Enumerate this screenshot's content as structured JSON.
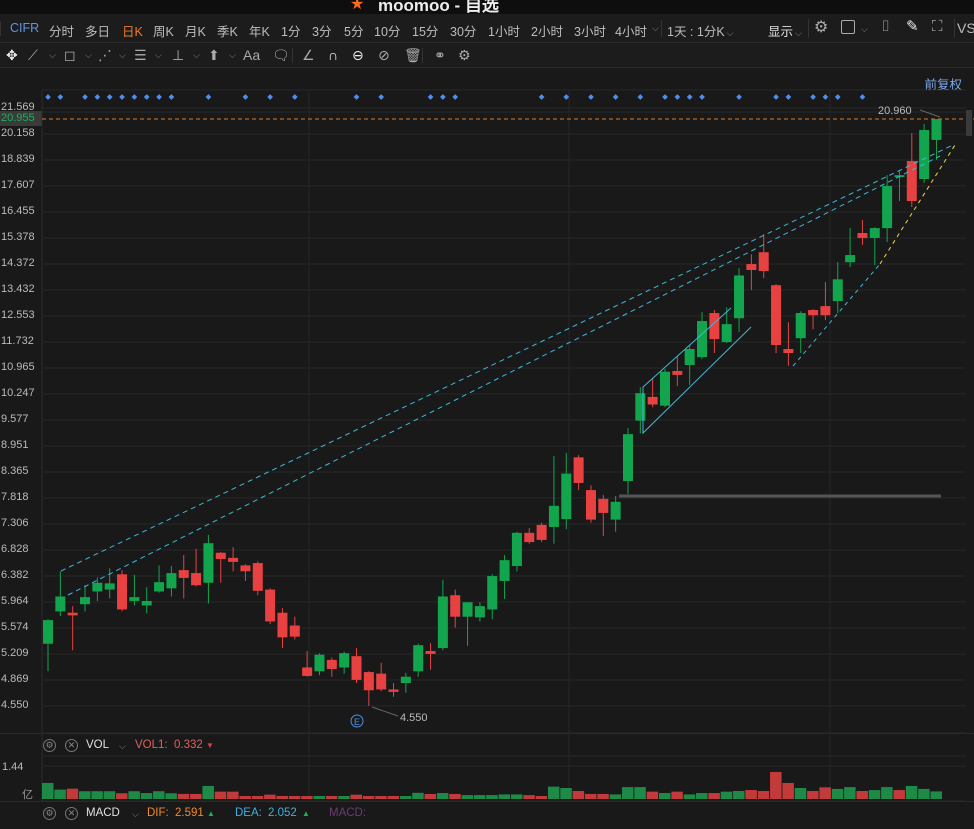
{
  "window": {
    "title": "moomoo - 自选",
    "logo": "moomoo-logo"
  },
  "toolbar": {
    "symbol": "CIFR",
    "periods": [
      "分时",
      "多日",
      "日K",
      "周K",
      "月K",
      "季K",
      "年K",
      "1分",
      "3分",
      "5分",
      "10分",
      "15分",
      "30分",
      "1小时",
      "2小时",
      "3小时",
      "4小时"
    ],
    "active_period": "日K",
    "multi_period": "1天 : 1分K",
    "display_label": "显示",
    "cut_label": "VS",
    "icons": [
      "gear-icon",
      "square-icon",
      "camera-icon",
      "pencil-icon",
      "fullscreen-icon"
    ]
  },
  "drawing_tools": [
    {
      "name": "move-icon",
      "glyph": "✥"
    },
    {
      "name": "trend-line-icon",
      "glyph": "⟋"
    },
    {
      "name": "rectangle-icon",
      "glyph": "◻"
    },
    {
      "name": "polyline-icon",
      "glyph": "⋰"
    },
    {
      "name": "fibonacci-icon",
      "glyph": "☰"
    },
    {
      "name": "measure-icon",
      "glyph": "⊥"
    },
    {
      "name": "arrow-up-icon",
      "glyph": "⬆"
    },
    {
      "name": "text-icon",
      "glyph": "Aa"
    },
    {
      "name": "comment-icon",
      "glyph": "🗨"
    },
    {
      "name": "angle-icon",
      "glyph": "∠"
    },
    {
      "name": "magnet-icon",
      "glyph": "∩"
    },
    {
      "name": "link-icon",
      "glyph": "⊖"
    },
    {
      "name": "hide-icon",
      "glyph": "⊘"
    },
    {
      "name": "trash-icon",
      "glyph": "🗑"
    },
    {
      "name": "rings-icon",
      "glyph": "⚭"
    },
    {
      "name": "settings-icon",
      "glyph": "⚙"
    }
  ],
  "adjust_label": "前复权",
  "colors": {
    "up": "#12a54d",
    "down": "#e84142",
    "bg": "#191919",
    "accent": "#f07a2a",
    "marker": "#4d8ff0",
    "trend": "#3fb8d8",
    "trend2": "#e8d84a"
  },
  "price_axis": {
    "labels": [
      "21.569",
      "20.158",
      "18.839",
      "17.607",
      "16.455",
      "15.378",
      "14.372",
      "13.432",
      "12.553",
      "11.732",
      "10.965",
      "10.247",
      "9.577",
      "8.951",
      "8.365",
      "7.818",
      "7.306",
      "6.828",
      "6.382",
      "5.964",
      "5.574",
      "5.209",
      "4.869",
      "4.550"
    ],
    "current": "20.955",
    "high_label": "20.960",
    "low_label": "4.550",
    "event_label": "E"
  },
  "chart_data": {
    "type": "candlestick",
    "scale": "log",
    "ylim": [
      4.55,
      21.569
    ],
    "ohlc": [
      [
        5.35,
        5.7,
        4.98,
        5.69
      ],
      [
        5.82,
        6.46,
        5.75,
        6.05
      ],
      [
        5.8,
        5.9,
        5.26,
        5.76
      ],
      [
        5.93,
        6.23,
        5.82,
        6.04
      ],
      [
        6.13,
        6.36,
        5.98,
        6.27
      ],
      [
        6.16,
        6.51,
        6.02,
        6.26
      ],
      [
        6.41,
        6.48,
        5.82,
        5.85
      ],
      [
        5.98,
        6.4,
        5.91,
        6.04
      ],
      [
        5.91,
        6.2,
        5.79,
        5.98
      ],
      [
        6.13,
        6.56,
        6.11,
        6.28
      ],
      [
        6.18,
        6.55,
        6.05,
        6.43
      ],
      [
        6.48,
        6.74,
        6.02,
        6.35
      ],
      [
        6.43,
        6.85,
        6.21,
        6.23
      ],
      [
        6.27,
        7.1,
        5.94,
        6.95
      ],
      [
        6.78,
        6.79,
        6.27,
        6.67
      ],
      [
        6.69,
        6.88,
        6.46,
        6.62
      ],
      [
        6.56,
        6.58,
        6.3,
        6.46
      ],
      [
        6.6,
        6.63,
        6.07,
        6.14
      ],
      [
        6.16,
        6.18,
        5.63,
        5.67
      ],
      [
        5.8,
        5.87,
        5.29,
        5.44
      ],
      [
        5.61,
        5.74,
        5.41,
        5.45
      ],
      [
        5.03,
        5.25,
        4.91,
        4.92
      ],
      [
        4.98,
        5.22,
        4.93,
        5.2
      ],
      [
        5.13,
        5.16,
        4.91,
        5.01
      ],
      [
        5.03,
        5.24,
        4.95,
        5.22
      ],
      [
        5.18,
        5.29,
        4.83,
        4.87
      ],
      [
        4.97,
        4.98,
        4.55,
        4.74
      ],
      [
        4.95,
        5.09,
        4.73,
        4.75
      ],
      [
        4.75,
        4.83,
        4.66,
        4.72
      ],
      [
        4.83,
        4.96,
        4.71,
        4.91
      ],
      [
        4.98,
        5.35,
        4.91,
        5.33
      ],
      [
        5.25,
        5.36,
        5.0,
        5.21
      ],
      [
        5.29,
        6.32,
        5.26,
        6.05
      ],
      [
        6.07,
        6.16,
        5.58,
        5.74
      ],
      [
        5.74,
        5.96,
        5.32,
        5.96
      ],
      [
        5.73,
        5.96,
        5.67,
        5.9
      ],
      [
        5.85,
        6.41,
        5.7,
        6.38
      ],
      [
        6.3,
        6.74,
        6.01,
        6.65
      ],
      [
        6.55,
        7.16,
        6.46,
        7.14
      ],
      [
        7.14,
        7.23,
        6.94,
        6.97
      ],
      [
        7.29,
        7.33,
        6.97,
        7.01
      ],
      [
        7.25,
        8.72,
        6.94,
        7.66
      ],
      [
        7.4,
        8.79,
        7.21,
        8.33
      ],
      [
        8.69,
        8.74,
        7.98,
        8.13
      ],
      [
        7.98,
        8.08,
        7.33,
        7.39
      ],
      [
        7.8,
        7.88,
        7.08,
        7.52
      ],
      [
        7.39,
        7.86,
        7.16,
        7.74
      ],
      [
        8.17,
        9.38,
        7.9,
        9.23
      ],
      [
        9.56,
        10.43,
        9.25,
        10.27
      ],
      [
        10.17,
        10.68,
        9.9,
        9.97
      ],
      [
        9.94,
        10.94,
        9.9,
        10.86
      ],
      [
        10.88,
        11.31,
        10.46,
        10.77
      ],
      [
        11.05,
        11.64,
        10.49,
        11.52
      ],
      [
        11.28,
        12.68,
        11.22,
        12.39
      ],
      [
        12.65,
        12.75,
        11.4,
        11.82
      ],
      [
        11.73,
        12.84,
        11.7,
        12.29
      ],
      [
        12.48,
        14.22,
        12.04,
        13.95
      ],
      [
        14.37,
        14.74,
        13.43,
        14.15
      ],
      [
        14.82,
        15.54,
        13.85,
        14.11
      ],
      [
        13.6,
        13.64,
        11.4,
        11.64
      ],
      [
        11.52,
        12.35,
        11.03,
        11.4
      ],
      [
        11.85,
        12.71,
        11.4,
        12.65
      ],
      [
        12.75,
        12.78,
        12.13,
        12.58
      ],
      [
        12.88,
        13.71,
        12.42,
        12.58
      ],
      [
        13.05,
        14.44,
        12.65,
        13.81
      ],
      [
        14.44,
        15.78,
        14.26,
        14.71
      ],
      [
        15.58,
        16.12,
        15.1,
        15.38
      ],
      [
        15.38,
        15.82,
        14.33,
        15.78
      ],
      [
        15.78,
        18.11,
        15.22,
        17.61
      ],
      [
        18.02,
        18.29,
        16.93,
        18.11
      ],
      [
        18.79,
        20.21,
        16.67,
        16.93
      ],
      [
        17.93,
        20.68,
        17.75,
        20.37
      ],
      [
        19.85,
        20.96,
        18.84,
        20.955
      ]
    ],
    "event_marker_candles": [
      0,
      1,
      3,
      4,
      5,
      6,
      7,
      8,
      9,
      10,
      13,
      16,
      18,
      20,
      25,
      27,
      31,
      32,
      33,
      40,
      42,
      44,
      46,
      48,
      50,
      51,
      52,
      53,
      56,
      59,
      60,
      62,
      63,
      64,
      66
    ],
    "last_price": 20.955
  },
  "volume": {
    "title": "VOL",
    "vol1_label": "VOL1:",
    "vol1_value": "0.332",
    "axis_label": "1.44",
    "unit_label": "亿",
    "axis_max": 1.44,
    "values": [
      0.7,
      0.41,
      0.45,
      0.34,
      0.34,
      0.34,
      0.25,
      0.34,
      0.26,
      0.34,
      0.25,
      0.22,
      0.22,
      0.57,
      0.32,
      0.32,
      0.13,
      0.13,
      0.19,
      0.13,
      0.13,
      0.13,
      0.13,
      0.13,
      0.13,
      0.19,
      0.13,
      0.13,
      0.13,
      0.13,
      0.27,
      0.22,
      0.26,
      0.22,
      0.17,
      0.17,
      0.17,
      0.2,
      0.2,
      0.17,
      0.13,
      0.54,
      0.48,
      0.35,
      0.22,
      0.22,
      0.2,
      0.52,
      0.52,
      0.32,
      0.26,
      0.32,
      0.2,
      0.26,
      0.26,
      0.32,
      0.35,
      0.39,
      0.35,
      1.18,
      0.7,
      0.48,
      0.35,
      0.51,
      0.44,
      0.52,
      0.35,
      0.39,
      0.52,
      0.39,
      0.57,
      0.44,
      0.332
    ],
    "up": [
      1,
      1,
      0,
      1,
      1,
      1,
      0,
      1,
      1,
      1,
      1,
      0,
      0,
      1,
      0,
      0,
      0,
      0,
      0,
      0,
      0,
      0,
      1,
      0,
      1,
      0,
      0,
      0,
      0,
      1,
      1,
      0,
      1,
      0,
      1,
      1,
      1,
      1,
      1,
      0,
      0,
      1,
      1,
      0,
      0,
      0,
      1,
      1,
      1,
      0,
      1,
      0,
      1,
      1,
      0,
      1,
      1,
      0,
      0,
      0,
      0,
      1,
      0,
      0,
      1,
      1,
      0,
      1,
      1,
      0,
      1,
      1,
      1
    ]
  },
  "macd": {
    "title": "MACD",
    "dif_label": "DIF:",
    "dif_value": "2.591",
    "dea_label": "DEA:",
    "dea_value": "2.052",
    "macd_label": "MACD:"
  }
}
